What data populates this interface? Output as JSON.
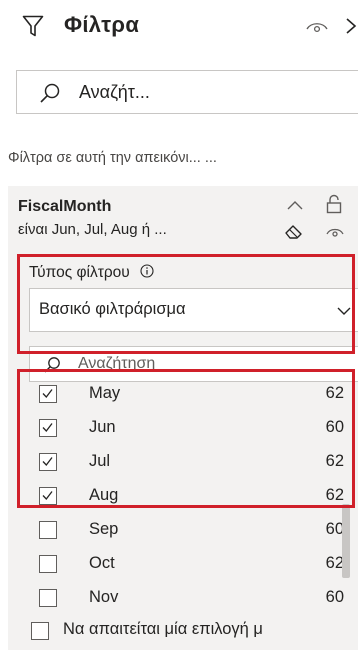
{
  "header": {
    "title": "Φίλτρα"
  },
  "search": {
    "text": "Αναζήτ..."
  },
  "section": {
    "label": "Φίλτρα σε αυτή την απεικόνι... ..."
  },
  "filter_card": {
    "field_name": "FiscalMonth",
    "summary": "είναι Jun, Jul, Aug ή ...",
    "filter_type_label": "Τύπος φίλτρου",
    "filter_type_value": "Βασικό φιλτράρισμα",
    "list_search_placeholder": "Αναζήτηση",
    "items": [
      {
        "label": "May",
        "count": "62",
        "checked": true
      },
      {
        "label": "Jun",
        "count": "60",
        "checked": true
      },
      {
        "label": "Jul",
        "count": "62",
        "checked": true
      },
      {
        "label": "Aug",
        "count": "62",
        "checked": true
      },
      {
        "label": "Sep",
        "count": "60",
        "checked": false
      },
      {
        "label": "Oct",
        "count": "62",
        "checked": false
      },
      {
        "label": "Nov",
        "count": "60",
        "checked": false
      }
    ],
    "require_single_selection": "Να απαιτείται μία επιλογή μ"
  },
  "colors": {
    "highlight": "#d0202a",
    "card_background": "#f3f2f1",
    "text": "#252423"
  },
  "icons": [
    "funnel-icon",
    "eye-icon",
    "chevron-right-icon",
    "search-icon",
    "collapse-icon",
    "lock-icon",
    "eraser-icon",
    "info-icon",
    "chevron-down-icon",
    "checkmark-icon"
  ]
}
